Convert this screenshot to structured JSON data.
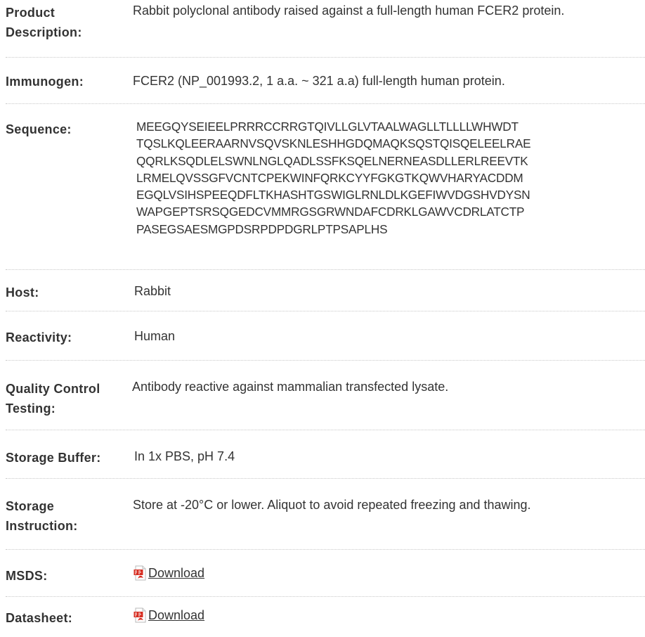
{
  "rows": [
    {
      "label": "Product Description:",
      "value": "Rabbit polyclonal antibody raised against a full-length human FCER2 protein."
    },
    {
      "label": "Immunogen:",
      "value": "FCER2 (NP_001993.2, 1 a.a. ~ 321 a.a) full-length human protein."
    },
    {
      "label": "Sequence:",
      "lines": [
        "MEEGQYSEIEELPRRRCCRRGTQIVLLGLVTAALWAGLLTLLLLWHWDT",
        "TQSLKQLEERAARNVSQVSKNLESHHGDQMAQKSQSTQISQELEELRAE",
        "QQRLKSQDLELSWNLNGLQADLSSFKSQELNERNEASDLLERLREEVTK",
        "LRMELQVSSGFVCNTCPEKWINFQRKCYYFGKGTKQWVHARYACDDM",
        "EGQLVSIHSPEEQDFLTKHASHTGSWIGLRNLDLKGEFIWVDGSHVDYSN",
        "WAPGEPTSRSQGEDCVMMRGSGRWNDAFCDRKLGAWVCDRLATCTP",
        "PASEGSAESMGPDSRPDPDGRLPTPSAPLHS"
      ]
    },
    {
      "label": "Host:",
      "value": "Rabbit"
    },
    {
      "label": "Reactivity:",
      "value": "Human"
    },
    {
      "label": "Quality Control Testing:",
      "value": "Antibody reactive against mammalian transfected lysate."
    },
    {
      "label": "Storage Buffer:",
      "value": "In 1x PBS, pH 7.4"
    },
    {
      "label": "Storage Instruction:",
      "value": "Store at -20°C or lower. Aliquot to avoid repeated freezing and thawing."
    },
    {
      "label": "MSDS:",
      "link": "Download",
      "icon": "pdf-icon"
    },
    {
      "label": "Datasheet:",
      "link": "Download",
      "icon": "pdf-icon"
    }
  ],
  "colors": {
    "text": "#333333",
    "divider": "#c8c8c8",
    "pdf_red": "#d62b1f"
  }
}
